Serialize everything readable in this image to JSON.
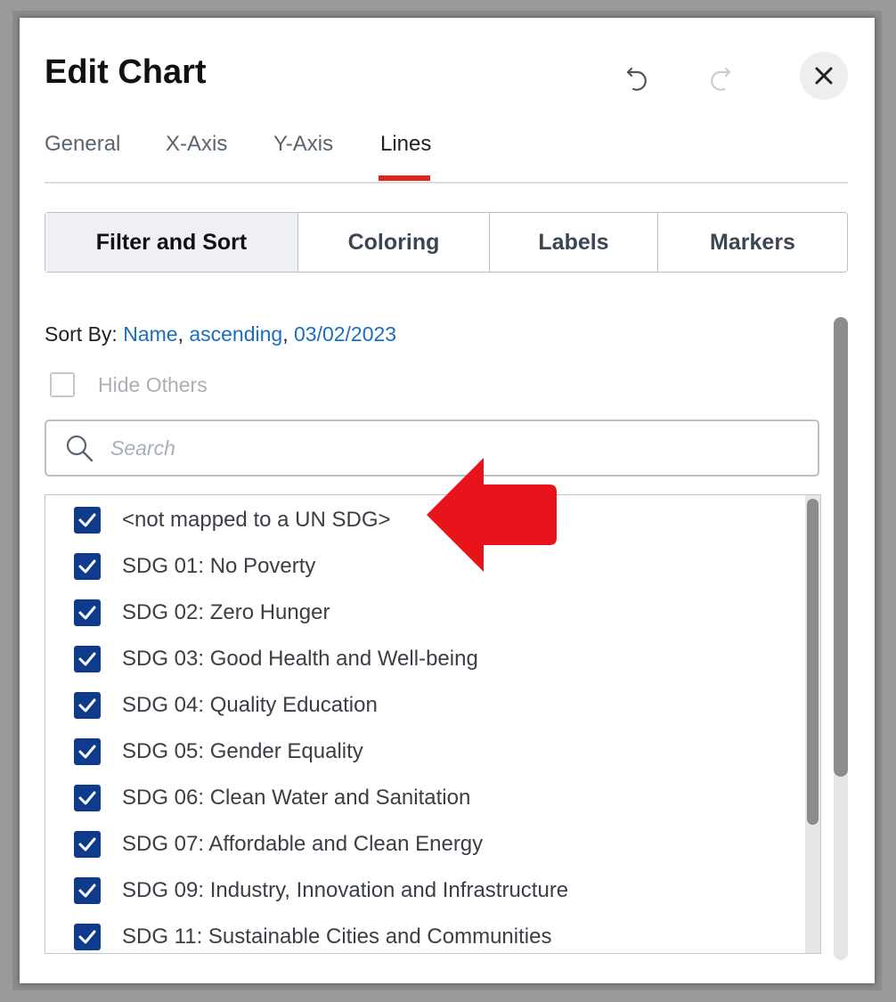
{
  "dialog": {
    "title": "Edit Chart",
    "undo_icon": "undo-icon",
    "redo_icon": "redo-icon",
    "close_icon": "close-icon"
  },
  "tabs": [
    {
      "label": "General",
      "active": false
    },
    {
      "label": "X-Axis",
      "active": false
    },
    {
      "label": "Y-Axis",
      "active": false
    },
    {
      "label": "Lines",
      "active": true
    }
  ],
  "subtabs": [
    {
      "label": "Filter and Sort",
      "active": true
    },
    {
      "label": "Coloring",
      "active": false
    },
    {
      "label": "Labels",
      "active": false
    },
    {
      "label": "Markers",
      "active": false
    }
  ],
  "sort": {
    "prefix": "Sort By: ",
    "field": "Name",
    "order": "ascending",
    "date": "03/02/2023"
  },
  "hide_others": {
    "label": "Hide Others",
    "checked": false
  },
  "search": {
    "placeholder": "Search",
    "value": ""
  },
  "items": [
    {
      "label": "<not mapped to a UN SDG>",
      "checked": true
    },
    {
      "label": "SDG 01: No Poverty",
      "checked": true
    },
    {
      "label": "SDG 02: Zero Hunger",
      "checked": true
    },
    {
      "label": "SDG 03: Good Health and Well-being",
      "checked": true
    },
    {
      "label": "SDG 04: Quality Education",
      "checked": true
    },
    {
      "label": "SDG 05: Gender Equality",
      "checked": true
    },
    {
      "label": "SDG 06: Clean Water and Sanitation",
      "checked": true
    },
    {
      "label": "SDG 07: Affordable and Clean Energy",
      "checked": true
    },
    {
      "label": "SDG 09: Industry, Innovation and Infrastructure",
      "checked": true
    },
    {
      "label": "SDG 11: Sustainable Cities and Communities",
      "checked": true
    }
  ],
  "colors": {
    "accent_red": "#e2231a",
    "checkbox_blue": "#0f3b8c",
    "link_blue": "#1a6fc0",
    "annotation_arrow": "#e8141c"
  },
  "annotation": {
    "icon": "left-arrow-icon"
  }
}
